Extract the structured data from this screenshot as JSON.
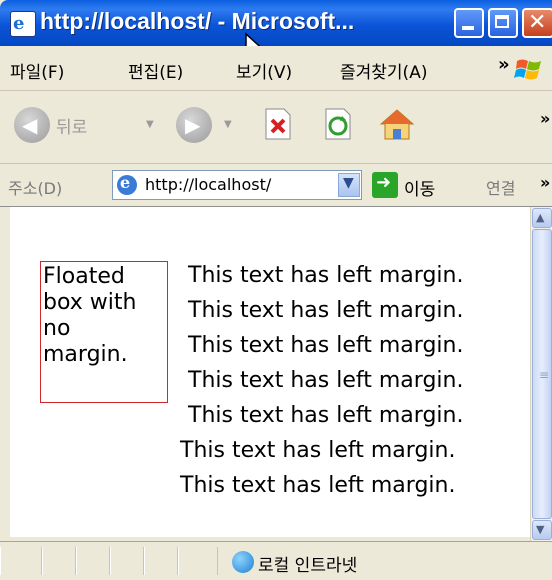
{
  "window": {
    "title": "http://localhost/ - Microsoft..."
  },
  "menu": {
    "items": [
      "파일(F)",
      "편집(E)",
      "보기(V)",
      "즐겨찾기(A)"
    ],
    "more": "»"
  },
  "toolbar": {
    "back_label": "뒤로",
    "more": "»"
  },
  "address": {
    "label": "주소(D)",
    "url": "http://localhost/",
    "go_label": "이동",
    "links_label": "연결",
    "more": "»"
  },
  "content": {
    "float_box_lines": [
      "Floated",
      "box with",
      "no",
      "margin."
    ],
    "text_lines": [
      "This text has left margin.",
      "This text has left margin.",
      "This text has left margin.",
      "This text has left margin.",
      "This text has left margin.",
      "This text has left margin.",
      "This text has left margin."
    ]
  },
  "status": {
    "zone": "로컬 인트라넷"
  },
  "colors": {
    "titlebar": "#0b54d8",
    "chrome": "#ece9d8",
    "float_border": "#cc2a2a"
  }
}
